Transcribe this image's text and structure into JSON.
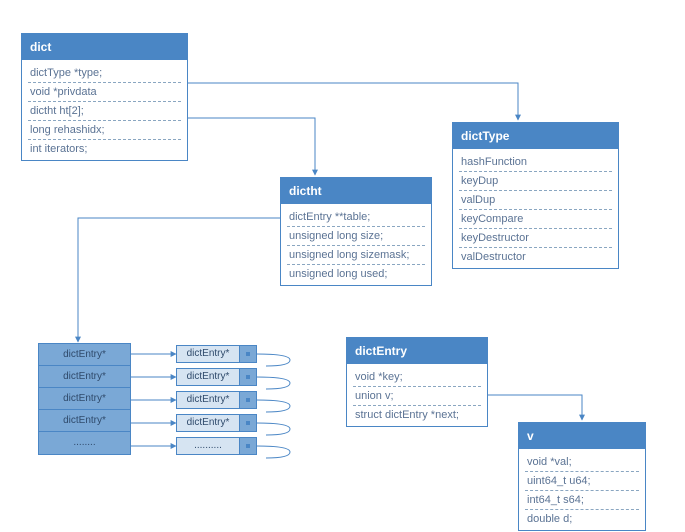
{
  "dict": {
    "title": "dict",
    "fields": [
      "dictType *type;",
      "void *privdata",
      "dictht ht[2];",
      "long rehashidx;",
      "int iterators;"
    ]
  },
  "dictType": {
    "title": "dictType",
    "fields": [
      "hashFunction",
      "keyDup",
      "valDup",
      "keyCompare",
      "keyDestructor",
      "valDestructor"
    ]
  },
  "dictht": {
    "title": "dictht",
    "fields": [
      "dictEntry **table;",
      "unsigned long size;",
      "unsigned long sizemask;",
      "unsigned long used;"
    ]
  },
  "dictEntry": {
    "title": "dictEntry",
    "fields": [
      "void *key;",
      "union v;",
      "struct dictEntry *next;"
    ]
  },
  "v": {
    "title": "v",
    "fields": [
      "void *val;",
      "uint64_t u64;",
      "int64_t s64;",
      "double d;"
    ]
  },
  "buckets": {
    "items": [
      "dictEntry*",
      "dictEntry*",
      "dictEntry*",
      "dictEntry*",
      "........"
    ]
  },
  "nodes": {
    "items": [
      "dictEntry*",
      "dictEntry*",
      "dictEntry*",
      "dictEntry*",
      ".........."
    ]
  }
}
